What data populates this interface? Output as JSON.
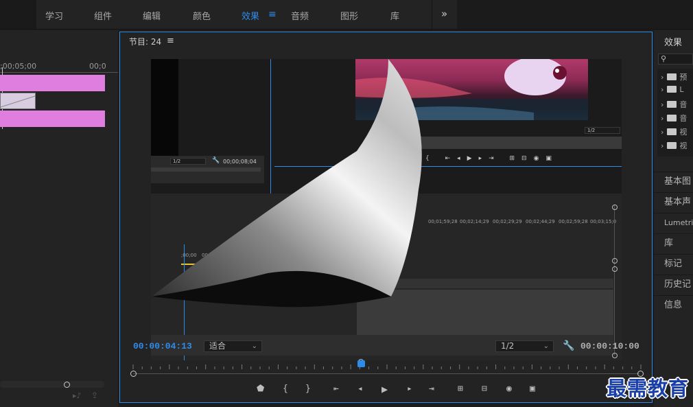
{
  "topbar": {
    "workspaces": [
      "学习",
      "组件",
      "编辑",
      "颜色",
      "效果",
      "音频",
      "图形",
      "库"
    ],
    "active": "效果",
    "more_icon": "double-chevron-right-icon",
    "menu_icon": "hamburger-icon"
  },
  "left_timeline": {
    "ruler_labels": [
      ";00;05;00",
      "00;0"
    ]
  },
  "program_monitor": {
    "title": "节目: 24",
    "menu_icon": "hamburger-icon",
    "timecode_current": "00:00:04:13",
    "zoom": {
      "value": "适合"
    },
    "resolution": {
      "value": "1/2"
    },
    "timecode_duration": "00:00:10:00",
    "playhead_progress": 0.45,
    "transport_icons": [
      "marker-icon",
      "mark-in-icon",
      "mark-out-icon",
      "go-to-in-icon",
      "step-back-icon",
      "play-icon",
      "step-forward-icon",
      "go-to-out-icon",
      "insert-icon",
      "overwrite-icon",
      "export-frame-icon",
      "comparison-view-icon"
    ]
  },
  "inner_preview": {
    "left_res": "1/2",
    "left_timecode": "00;00;08;04",
    "right_res": "1/2",
    "ruler_labels": [
      "00;01;59;28",
      "00;02;14;29",
      "00;02;29;29",
      "00;02;44;29",
      "00;02;59;28",
      "00;03;15;0"
    ],
    "mini_timecodes": [
      ";00;00",
      "00;00;14;29"
    ]
  },
  "effects_panel": {
    "title": "效果",
    "search_icon": "search-icon",
    "tree": [
      {
        "label": "预",
        "icon": "star-folder-icon"
      },
      {
        "label": "L",
        "icon": "star-folder-icon"
      },
      {
        "label": "音",
        "icon": "folder-icon"
      },
      {
        "label": "音",
        "icon": "folder-icon"
      },
      {
        "label": "视",
        "icon": "folder-icon"
      },
      {
        "label": "视",
        "icon": "folder-icon"
      }
    ],
    "tabs": [
      "基本图",
      "基本声",
      "Lumetri",
      "库",
      "标记",
      "历史记",
      "信息"
    ]
  },
  "watermark": "最需教育",
  "colors": {
    "accent": "#2d8ceb",
    "clip": "#e07ee0",
    "panel": "#232323"
  }
}
